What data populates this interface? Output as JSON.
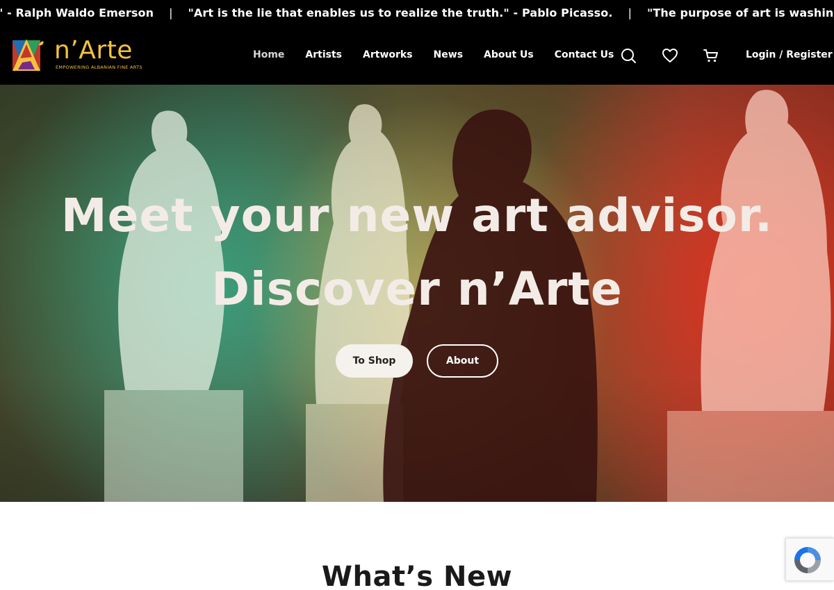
{
  "ticker": {
    "quotes": [
      "\" - Ralph Waldo Emerson",
      "\"Art is the lie that enables us to realize the truth.\" - Pablo Picasso.",
      "\"The purpose of art is washing the dust of daily life off our souls.\""
    ],
    "separator": "|"
  },
  "header": {
    "logo_text": "n’Arte",
    "logo_tagline": "EMPOWERING ALBANIAN FINE ARTS",
    "logo_icon": "narte-logo-mark",
    "nav": [
      {
        "label": "Home",
        "active": true
      },
      {
        "label": "Artists",
        "active": false
      },
      {
        "label": "Artworks",
        "active": false
      },
      {
        "label": "News",
        "active": false
      },
      {
        "label": "About Us",
        "active": false
      },
      {
        "label": "Contact Us",
        "active": false
      }
    ],
    "icons": [
      "search-icon",
      "heart-icon",
      "cart-icon"
    ],
    "login_label": "Login / Register"
  },
  "hero": {
    "title_line1": "Meet your new art advisor.",
    "title_line2": "Discover n’Arte",
    "shop_button": "To Shop",
    "about_button": "About",
    "background": "gallery-with-statues-photo"
  },
  "section": {
    "whats_new_title": "What’s New"
  },
  "colors": {
    "brand_gold": "#f4c23d",
    "header_bg": "#000000",
    "hero_text": "#f3ece6"
  }
}
